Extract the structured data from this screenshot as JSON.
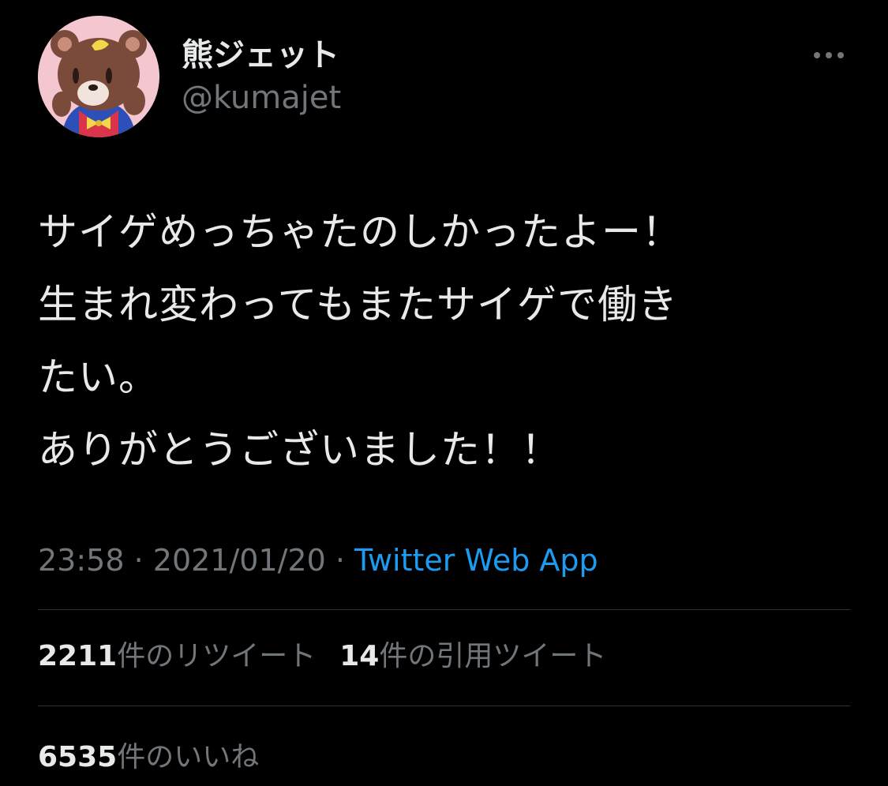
{
  "user": {
    "display_name": "熊ジェット",
    "handle": "@kumajet"
  },
  "tweet": {
    "lines": [
      "サイゲめっちゃたのしかったよー！",
      "生まれ変わってもまたサイゲで働き",
      "たい。",
      "ありがとうございました！！"
    ],
    "time": "23:58",
    "separator": " · ",
    "date": "2021/01/20",
    "source": "Twitter Web App"
  },
  "stats": {
    "retweets_count": "2211",
    "retweets_label": "件のリツイート",
    "quotes_count": "14",
    "quotes_label": "件の引用ツイート",
    "likes_count": "6535",
    "likes_label": "件のいいね"
  },
  "icons": {
    "more": "more-horizontal-icon",
    "avatar": "bear-avatar"
  },
  "colors": {
    "background": "#000000",
    "text": "#e7e9ea",
    "muted": "#71767b",
    "link": "#1d9bf0",
    "divider": "#2f3336"
  }
}
